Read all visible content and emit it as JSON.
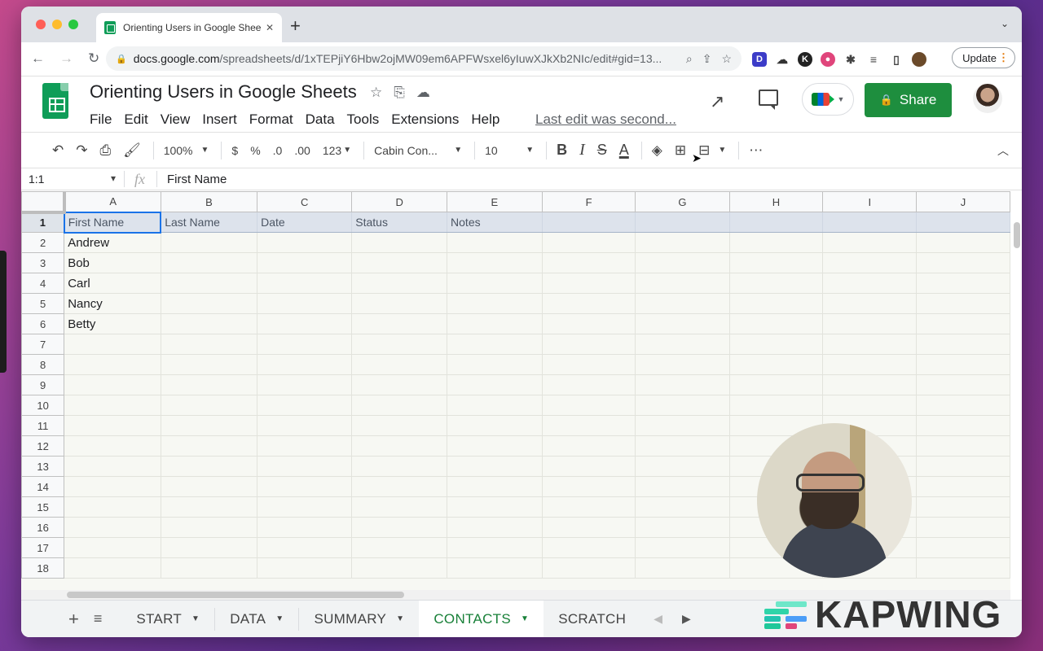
{
  "browser": {
    "tab_title": "Orienting Users in Google Sheets",
    "tab_close": "✕",
    "new_tab": "+",
    "url_host": "docs.google.com",
    "url_path": "/spreadsheets/d/1xTEPjiY6Hbw2ojMW09em6APFWsxel6yIuwXJkXb2NIc/edit#gid=13...",
    "update_label": "Update"
  },
  "doc": {
    "title": "Orienting Users in Google Sheets",
    "menus": [
      "File",
      "Edit",
      "View",
      "Insert",
      "Format",
      "Data",
      "Tools",
      "Extensions",
      "Help"
    ],
    "last_edit": "Last edit was second...",
    "share_label": "Share"
  },
  "toolbar": {
    "zoom": "100%",
    "currency": "$",
    "percent": "%",
    "dec_less": ".0",
    "dec_more": ".00",
    "more_formats": "123",
    "font": "Cabin Con...",
    "font_size": "10",
    "bold": "B",
    "italic": "I",
    "strike": "S",
    "text_color": "A",
    "more": "⋯"
  },
  "formula_bar": {
    "name_box": "1:1",
    "fx": "fx",
    "content": "First Name"
  },
  "grid": {
    "columns": [
      "A",
      "B",
      "C",
      "D",
      "E",
      "F",
      "G",
      "H",
      "I",
      "J"
    ],
    "rows": [
      "1",
      "2",
      "3",
      "4",
      "5",
      "6",
      "7",
      "8",
      "9",
      "10",
      "11",
      "12",
      "13",
      "14",
      "15",
      "16",
      "17",
      "18"
    ],
    "header_row": [
      "First Name",
      "Last Name",
      "Date",
      "Status",
      "Notes",
      "",
      "",
      "",
      "",
      ""
    ],
    "names": [
      "Andrew",
      "Bob",
      "Carl",
      "Nancy",
      "Betty"
    ]
  },
  "sheets": {
    "tabs": [
      "START",
      "DATA",
      "SUMMARY",
      "CONTACTS",
      "SCRATCH"
    ],
    "active": "CONTACTS"
  },
  "watermark": "KAPWING",
  "colors": {
    "share_green": "#1e8e3e",
    "active_tab": "#188038",
    "selection_blue": "#1a73e8",
    "header_fill": "#dde3ec"
  }
}
